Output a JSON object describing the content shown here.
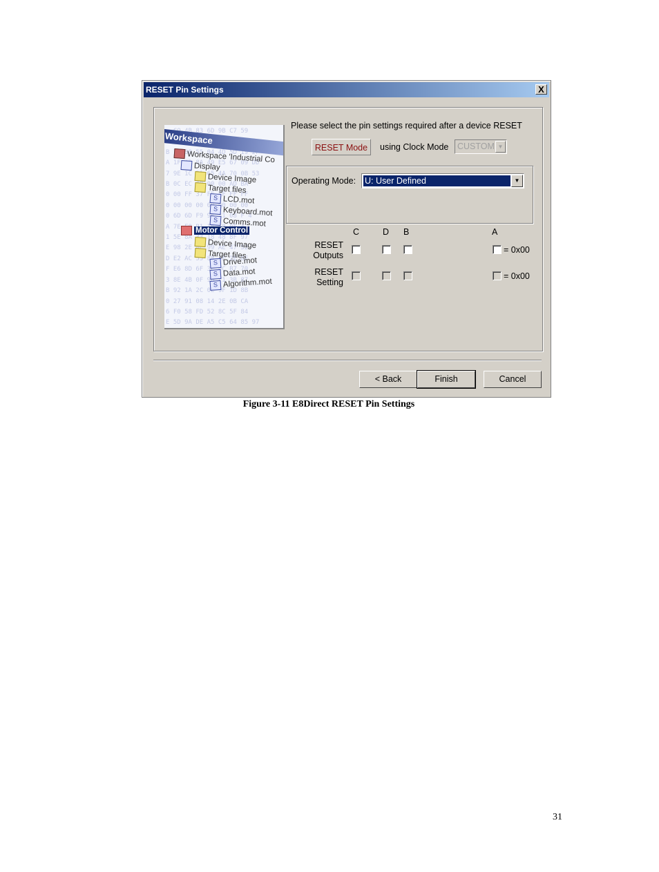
{
  "dialog": {
    "title": "RESET Pin Settings",
    "close_label": "X",
    "instruction": "Please select the pin settings required after a device RESET",
    "reset_mode_label": "RESET Mode",
    "clock_mode_label": "using Clock Mode",
    "clock_mode_value": "CUSTOM",
    "operating_mode_label": "Operating Mode:",
    "operating_mode_value": "U: User Defined",
    "columns": [
      "C",
      "D",
      "B",
      "A"
    ],
    "rows": [
      {
        "label_line1": "RESET",
        "label_line2": "Outputs",
        "enabled": true,
        "checked": [
          false,
          false,
          false,
          false
        ],
        "value": "= 0x00"
      },
      {
        "label_line1": "RESET",
        "label_line2": "Setting",
        "enabled": false,
        "checked": [
          false,
          false,
          false,
          false
        ],
        "value": "= 0x00"
      }
    ],
    "buttons": {
      "back": "< Back",
      "finish": "Finish",
      "cancel": "Cancel"
    }
  },
  "illustration": {
    "header": "Workspace",
    "items": [
      {
        "text": "Workspace 'Industrial Co",
        "icon": "workspace-icon",
        "selected": false
      },
      {
        "text": "Display",
        "icon": "project-icon",
        "selected": false
      },
      {
        "text": "Device Image",
        "icon": "folder-icon",
        "selected": false
      },
      {
        "text": "Target files",
        "icon": "folder-icon",
        "selected": false
      },
      {
        "text": "LCD.mot",
        "icon": "file-icon",
        "selected": false
      },
      {
        "text": "Keyboard.mot",
        "icon": "file-icon",
        "selected": false
      },
      {
        "text": "Comms.mot",
        "icon": "file-icon",
        "selected": false
      },
      {
        "text": "Motor Control",
        "icon": "project-icon",
        "selected": true
      },
      {
        "text": "Device Image",
        "icon": "folder-icon",
        "selected": false
      },
      {
        "text": "Target files",
        "icon": "folder-icon",
        "selected": false
      },
      {
        "text": "Drive.mot",
        "icon": "file-icon",
        "selected": false
      },
      {
        "text": "Data.mot",
        "icon": "file-icon",
        "selected": false
      },
      {
        "text": "Algorithm.mot",
        "icon": "file-icon",
        "selected": false
      }
    ]
  },
  "caption": "Figure 3-11 E8Direct RESET Pin Settings",
  "page_number": "31"
}
